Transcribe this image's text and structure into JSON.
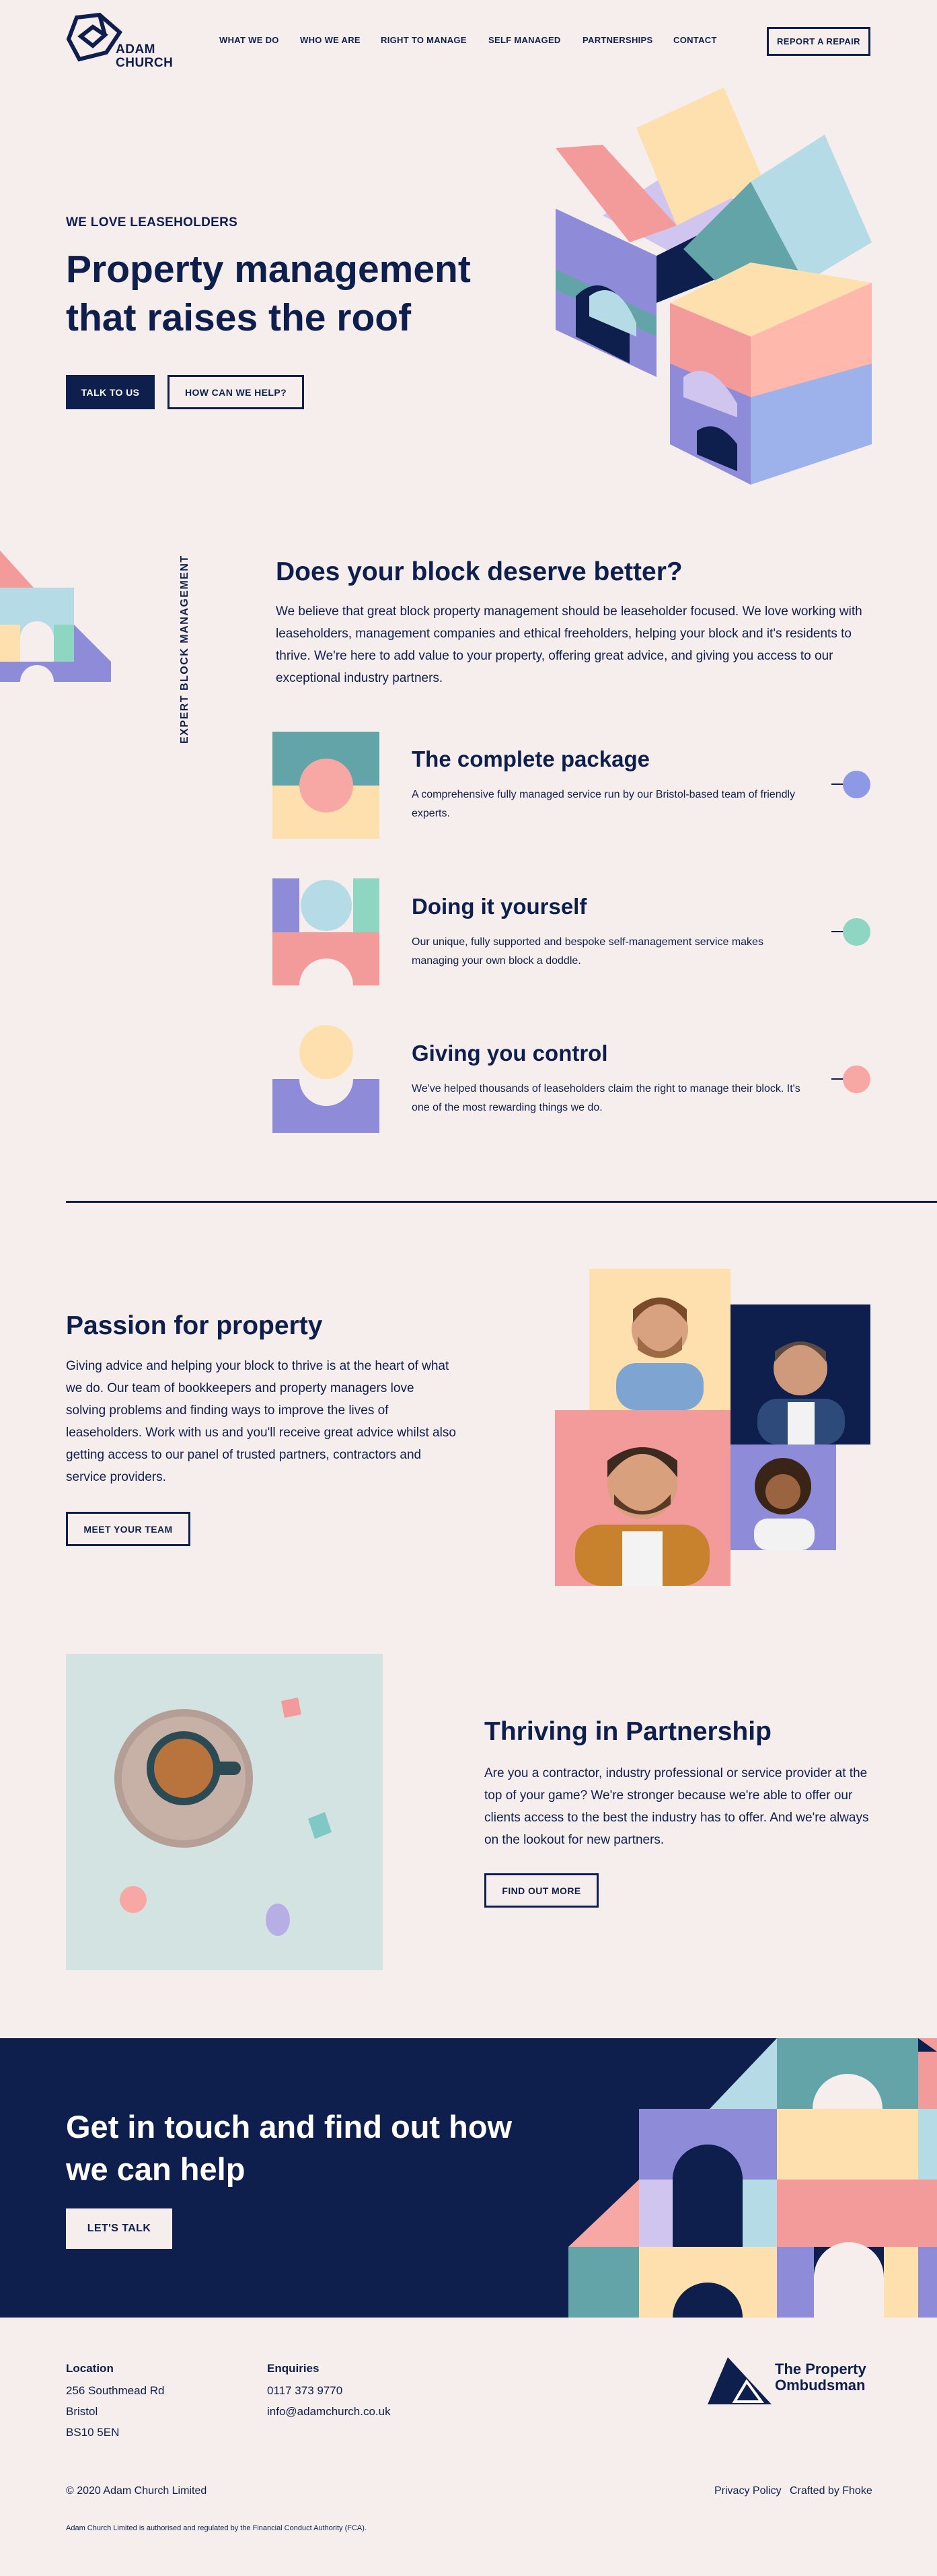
{
  "header": {
    "logo_text_line1": "ADAM",
    "logo_text_line2": "CHURCH",
    "nav": [
      "WHAT WE DO",
      "WHO WE ARE",
      "RIGHT TO MANAGE",
      "SELF MANAGED",
      "PARTNERSHIPS",
      "CONTACT"
    ],
    "report_button": "REPORT A REPAIR"
  },
  "hero": {
    "eyebrow": "WE LOVE LEASEHOLDERS",
    "title_line1": "Property management",
    "title_line2": "that raises the roof",
    "primary_button": "TALK TO US",
    "secondary_button": "HOW CAN WE HELP?"
  },
  "block_section": {
    "vertical_label": "EXPERT BLOCK MANAGEMENT",
    "title": "Does your block deserve better?",
    "intro": "We believe that great block property management should be leaseholder focused. We love working with leaseholders, management companies and ethical freeholders, helping your block and it's residents to thrive. We're here to add value to your property, offering great advice, and giving you access to our exceptional industry partners.",
    "services": [
      {
        "title": "The complete package",
        "text": "A comprehensive fully managed service run by our Bristol-based team of friendly experts."
      },
      {
        "title": "Doing it yourself",
        "text": "Our unique, fully supported and bespoke self-management service makes managing your own block a doddle."
      },
      {
        "title": "Giving you control",
        "text": "We've helped thousands of leaseholders claim the right to manage their block. It's one of the most rewarding things we do."
      }
    ]
  },
  "passion": {
    "title": "Passion for property",
    "text": "Giving advice and helping your block to thrive is at the heart of what we do. Our team of bookkeepers and property managers love solving problems and finding ways to improve the lives of leaseholders. Work with us and you'll receive great advice whilst also getting access to our panel of trusted partners, contractors and service providers.",
    "button": "MEET YOUR TEAM"
  },
  "partnership": {
    "title": "Thriving in Partnership",
    "text": "Are you a contractor, industry professional or service provider at the top of your game? We're stronger because we're able to offer our clients access to the best the industry has to offer. And we're always on the lookout for new partners.",
    "button": "FIND OUT MORE"
  },
  "cta": {
    "title_line1": "Get in touch and find out how",
    "title_line2": "we can help",
    "button": "LET'S TALK"
  },
  "footer": {
    "location_title": "Location",
    "location_lines": [
      "256 Southmead Rd",
      "Bristol",
      "BS10 5EN"
    ],
    "enquiries_title": "Enquiries",
    "phone": "0117 373 9770",
    "email": "info@adamchurch.co.uk",
    "ombudsman_line1": "The Property",
    "ombudsman_line2": "Ombudsman",
    "copyright": "© 2020 Adam Church Limited",
    "privacy": "Privacy Policy",
    "crafted": "Crafted by Fhoke",
    "legal": "Adam Church Limited is authorised and regulated by the Financial Conduct Authority (FCA)."
  },
  "colors": {
    "background": "#f6eeec",
    "navy": "#0e1f4d",
    "pink": "#f39b9b",
    "peach": "#fde0ad",
    "lilac": "#8e8bd8",
    "teal": "#62a4a8",
    "sky": "#b5dce6",
    "mint": "#8fd6c2"
  }
}
